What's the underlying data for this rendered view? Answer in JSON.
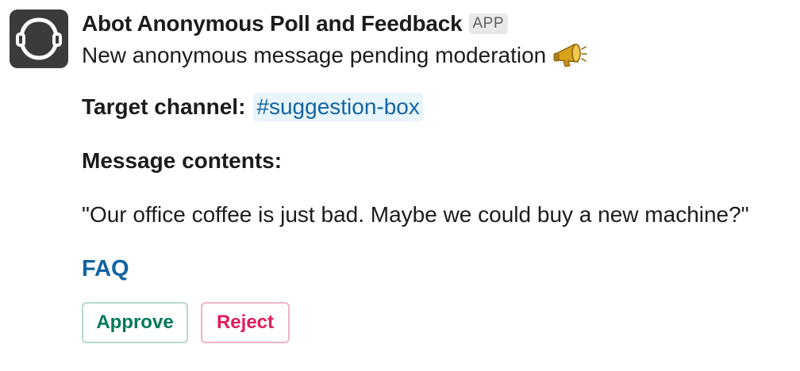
{
  "message": {
    "sender": "Abot Anonymous Poll and Feedback",
    "badge": "APP",
    "notice": "New anonymous message pending moderation",
    "notice_icon": "megaphone-icon",
    "target_label": "Target channel:",
    "target_channel": "#suggestion-box",
    "contents_label": "Message contents:",
    "contents": "\"Our office coffee is just bad. Maybe we could buy a new machine?\"",
    "faq_link": "FAQ"
  },
  "actions": {
    "approve_label": "Approve",
    "reject_label": "Reject"
  },
  "colors": {
    "link": "#1264a3",
    "channel_bg": "#e8f5fa",
    "approve": "#007a5a",
    "reject": "#e01e5a",
    "avatar_bg": "#3b3b3d"
  }
}
